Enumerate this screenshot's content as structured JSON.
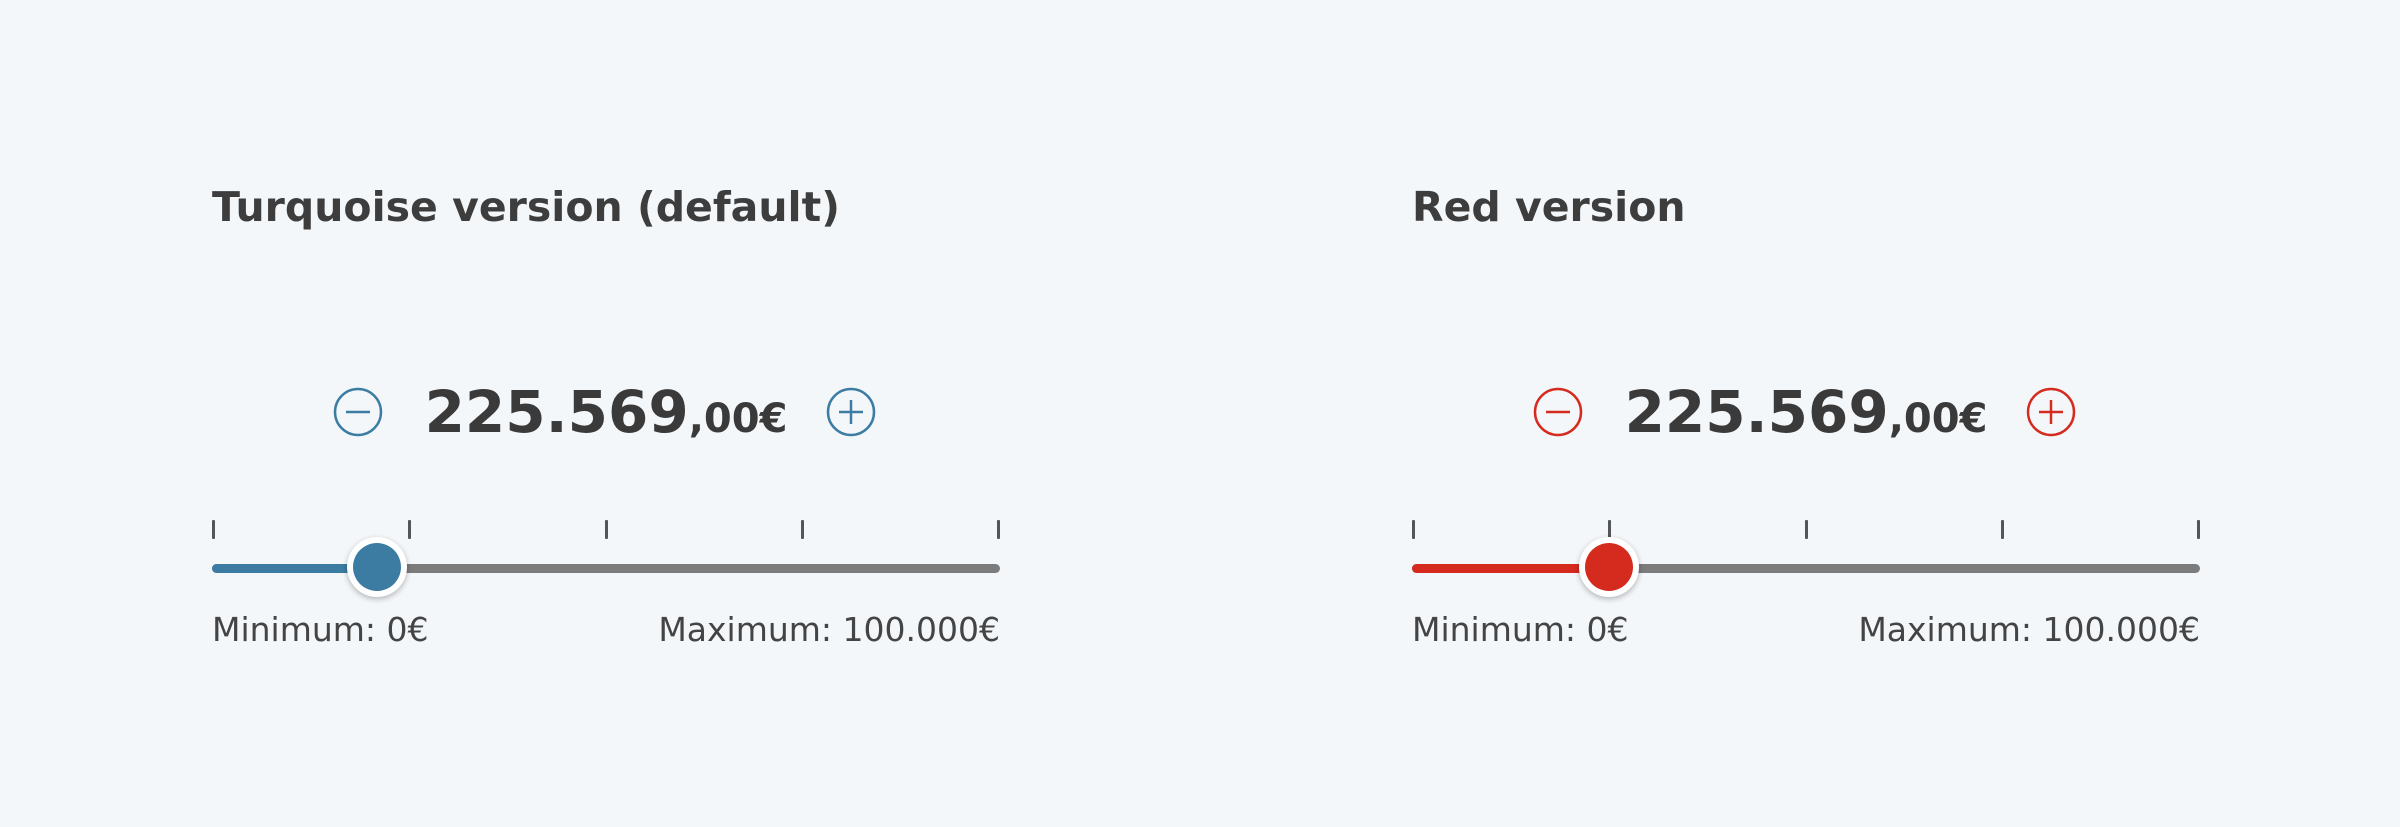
{
  "colors": {
    "background": "#f4f7fa",
    "track": "#7c7c7c",
    "text": "#3a3a3a"
  },
  "sliders": [
    {
      "title": "Turquoise version (default)",
      "accent": "#3c7ca3",
      "value_integer": "225.569",
      "value_decimal": ",00€",
      "minimum_label": "Minimum: 0€",
      "maximum_label": "Maximum: 100.000€",
      "thumb_fraction": 0.21,
      "tick_fractions": [
        0,
        0.25,
        0.5,
        0.75,
        1
      ],
      "minus_icon": "minus-circle-icon",
      "plus_icon": "plus-circle-icon"
    },
    {
      "title": "Red version",
      "accent": "#d52b1e",
      "value_integer": "225.569",
      "value_decimal": ",00€",
      "minimum_label": "Minimum: 0€",
      "maximum_label": "Maximum: 100.000€",
      "thumb_fraction": 0.25,
      "tick_fractions": [
        0,
        0.25,
        0.5,
        0.75,
        1
      ],
      "minus_icon": "minus-circle-icon",
      "plus_icon": "plus-circle-icon"
    }
  ]
}
